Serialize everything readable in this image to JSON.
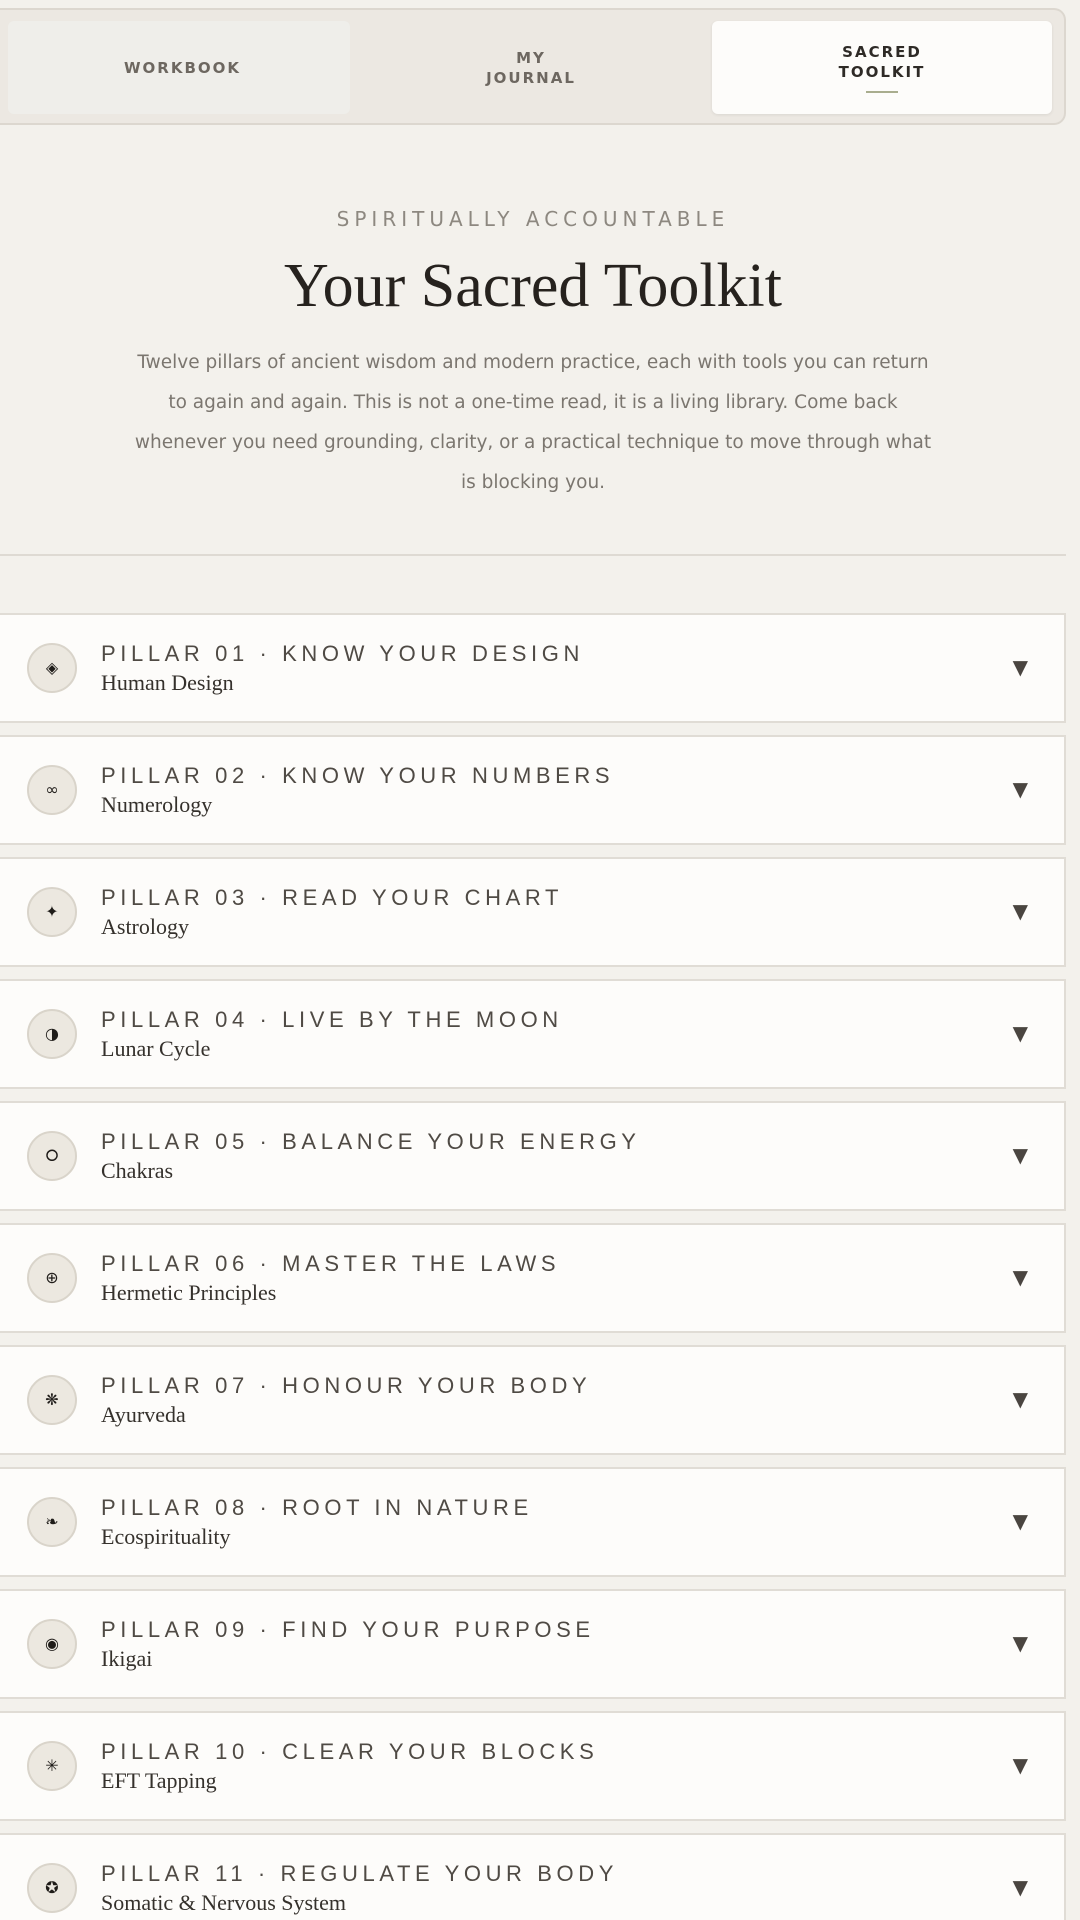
{
  "tabs": [
    {
      "label": "WORKBOOK",
      "active": false
    },
    {
      "label": "MY JOURNAL",
      "active": false
    },
    {
      "label": "SACRED TOOLKIT",
      "active": true
    }
  ],
  "hero": {
    "eyebrow": "SPIRITUALLY ACCOUNTABLE",
    "title": "Your Sacred Toolkit",
    "description": "Twelve pillars of ancient wisdom and modern practice, each with tools you can return to again and again. This is not a one-time read, it is a living library. Come back whenever you need grounding, clarity, or a practical technique to move through what is blocking you."
  },
  "pillars": [
    {
      "heading": "PILLAR 01 · KNOW YOUR DESIGN",
      "subtitle": "Human Design",
      "icon": "◈",
      "icon_name": "diamond-icon"
    },
    {
      "heading": "PILLAR 02 · KNOW YOUR NUMBERS",
      "subtitle": "Numerology",
      "icon": "∞",
      "icon_name": "infinity-icon"
    },
    {
      "heading": "PILLAR 03 · READ YOUR CHART",
      "subtitle": "Astrology",
      "icon": "✦",
      "icon_name": "star-icon"
    },
    {
      "heading": "PILLAR 04 · LIVE BY THE MOON",
      "subtitle": "Lunar Cycle",
      "icon": "◑",
      "icon_name": "half-moon-icon"
    },
    {
      "heading": "PILLAR 05 · BALANCE YOUR ENERGY",
      "subtitle": "Chakras",
      "icon": "⭘",
      "icon_name": "ring-icon"
    },
    {
      "heading": "PILLAR 06 · MASTER THE LAWS",
      "subtitle": "Hermetic Principles",
      "icon": "⊕",
      "icon_name": "circled-plus-icon"
    },
    {
      "heading": "PILLAR 07 · HONOUR YOUR BODY",
      "subtitle": "Ayurveda",
      "icon": "❋",
      "icon_name": "flower-icon"
    },
    {
      "heading": "PILLAR 08 · ROOT IN NATURE",
      "subtitle": "Ecospirituality",
      "icon": "❧",
      "icon_name": "leaf-icon"
    },
    {
      "heading": "PILLAR 09 · FIND YOUR PURPOSE",
      "subtitle": "Ikigai",
      "icon": "◉",
      "icon_name": "target-icon"
    },
    {
      "heading": "PILLAR 10 · CLEAR YOUR BLOCKS",
      "subtitle": "EFT Tapping",
      "icon": "✳",
      "icon_name": "asterisk-icon"
    },
    {
      "heading": "PILLAR 11 · REGULATE YOUR BODY",
      "subtitle": "Somatic & Nervous System",
      "icon": "✪",
      "icon_name": "circled-star-icon"
    }
  ],
  "chevron": "▼"
}
